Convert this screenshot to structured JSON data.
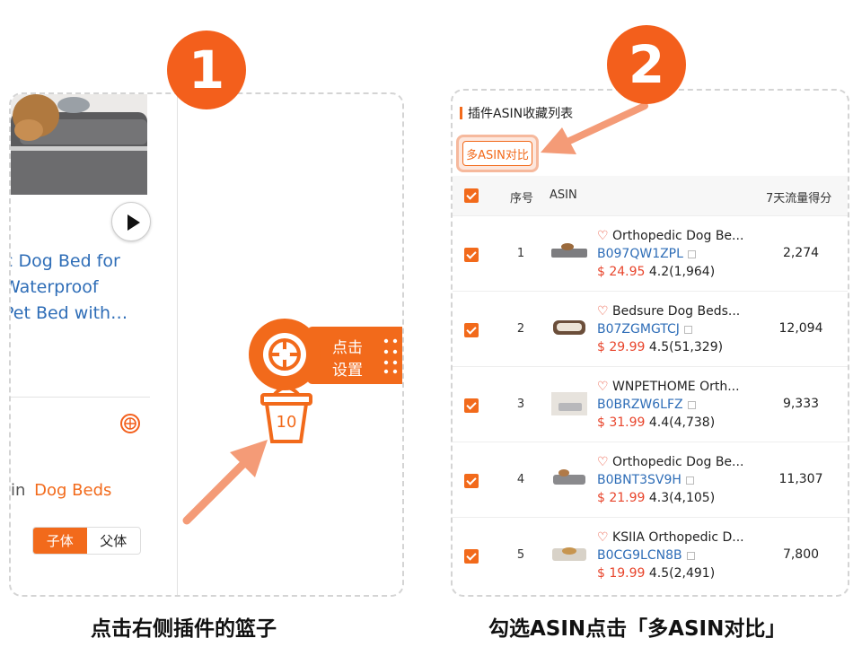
{
  "left": {
    "step": "1",
    "title_lines": [
      "c Dog Bed for",
      "Waterproof",
      " Pet Bed with…"
    ],
    "category_prefix": "in",
    "category_link": "Dog Beds",
    "toggle": {
      "child": "子体",
      "parent": "父体"
    },
    "settings_label_1": "点击",
    "settings_label_2": "设置",
    "basket_count": "10",
    "caption": "点击右侧插件的篮子"
  },
  "right": {
    "step": "2",
    "heading": "插件ASIN收藏列表",
    "compare_button": "多ASIN对比",
    "columns": {
      "index": "序号",
      "asin": "ASIN",
      "score": "7天流量得分"
    },
    "rows": [
      {
        "index": "1",
        "title": "Orthopedic Dog Be...",
        "asin": "B097QW1ZPL",
        "price": "$ 24.95",
        "rating": "4.2(1,964)",
        "score": "2,274"
      },
      {
        "index": "2",
        "title": "Bedsure Dog Beds...",
        "asin": "B07ZGMGTCJ",
        "price": "$ 29.99",
        "rating": "4.5(51,329)",
        "score": "12,094"
      },
      {
        "index": "3",
        "title": "WNPETHOME Orth...",
        "asin": "B0BRZW6LFZ",
        "price": "$ 31.99",
        "rating": "4.4(4,738)",
        "score": "9,333"
      },
      {
        "index": "4",
        "title": "Orthopedic Dog Be...",
        "asin": "B0BNT3SV9H",
        "price": "$ 21.99",
        "rating": "4.3(4,105)",
        "score": "11,307"
      },
      {
        "index": "5",
        "title": "KSIIA Orthopedic D...",
        "asin": "B0CG9LCN8B",
        "price": "$ 19.99",
        "rating": "4.5(2,491)",
        "score": "7,800"
      }
    ],
    "caption": "勾选ASIN点击「多ASIN对比」"
  },
  "colors": {
    "accent": "#f35f1c",
    "link": "#2e6db7",
    "price": "#e8452c",
    "arrow": "#f49b77"
  }
}
